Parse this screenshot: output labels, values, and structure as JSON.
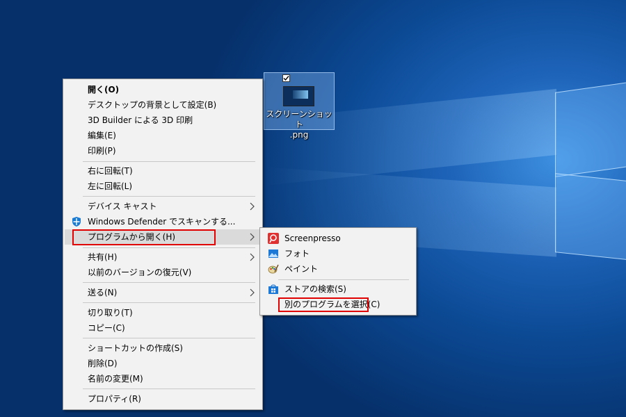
{
  "desktop_icon": {
    "label_line1": "スクリーンショット",
    "label_line2": ".png",
    "checked": true
  },
  "context_menu": {
    "items": [
      {
        "label": "開く(O)"
      },
      {
        "label": "デスクトップの背景として設定(B)"
      },
      {
        "label": "3D Builder による 3D 印刷"
      },
      {
        "label": "編集(E)"
      },
      {
        "label": "印刷(P)"
      },
      {
        "label": "右に回転(T)"
      },
      {
        "label": "左に回転(L)"
      },
      {
        "label": "デバイス キャスト"
      },
      {
        "label": "Windows Defender でスキャンする..."
      },
      {
        "label": "プログラムから開く(H)"
      },
      {
        "label": "共有(H)"
      },
      {
        "label": "以前のバージョンの復元(V)"
      },
      {
        "label": "送る(N)"
      },
      {
        "label": "切り取り(T)"
      },
      {
        "label": "コピー(C)"
      },
      {
        "label": "ショートカットの作成(S)"
      },
      {
        "label": "削除(D)"
      },
      {
        "label": "名前の変更(M)"
      },
      {
        "label": "プロパティ(R)"
      }
    ]
  },
  "open_with_submenu": {
    "items": [
      {
        "label": "Screenpresso",
        "icon": "screenpresso-icon"
      },
      {
        "label": "フォト",
        "icon": "photos-icon"
      },
      {
        "label": "ペイント",
        "icon": "paint-icon"
      },
      {
        "label": "ストアの検索(S)",
        "icon": "store-icon"
      },
      {
        "label": "別のプログラムを選択(C)",
        "icon": ""
      }
    ]
  },
  "colors": {
    "highlight_box": "#e00000",
    "menu_background": "#f2f2f2",
    "hover_background": "#dadada"
  }
}
